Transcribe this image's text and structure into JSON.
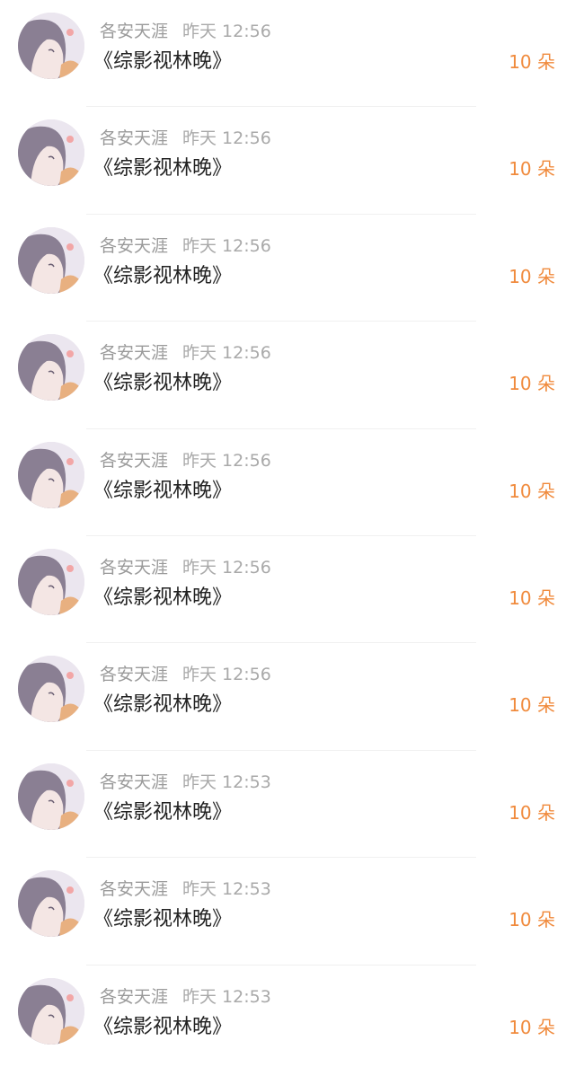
{
  "items": [
    {
      "user": "各安天涯",
      "time": "昨天 12:56",
      "book": "《综影视林晚》",
      "amount": "10 朵"
    },
    {
      "user": "各安天涯",
      "time": "昨天 12:56",
      "book": "《综影视林晚》",
      "amount": "10 朵"
    },
    {
      "user": "各安天涯",
      "time": "昨天 12:56",
      "book": "《综影视林晚》",
      "amount": "10 朵"
    },
    {
      "user": "各安天涯",
      "time": "昨天 12:56",
      "book": "《综影视林晚》",
      "amount": "10 朵"
    },
    {
      "user": "各安天涯",
      "time": "昨天 12:56",
      "book": "《综影视林晚》",
      "amount": "10 朵"
    },
    {
      "user": "各安天涯",
      "time": "昨天 12:56",
      "book": "《综影视林晚》",
      "amount": "10 朵"
    },
    {
      "user": "各安天涯",
      "time": "昨天 12:56",
      "book": "《综影视林晚》",
      "amount": "10 朵"
    },
    {
      "user": "各安天涯",
      "time": "昨天 12:53",
      "book": "《综影视林晚》",
      "amount": "10 朵"
    },
    {
      "user": "各安天涯",
      "time": "昨天 12:53",
      "book": "《综影视林晚》",
      "amount": "10 朵"
    },
    {
      "user": "各安天涯",
      "time": "昨天 12:53",
      "book": "《综影视林晚》",
      "amount": "10 朵"
    }
  ],
  "colors": {
    "accent": "#f08a3c",
    "meta": "#9a9a9a",
    "title": "#222222"
  }
}
